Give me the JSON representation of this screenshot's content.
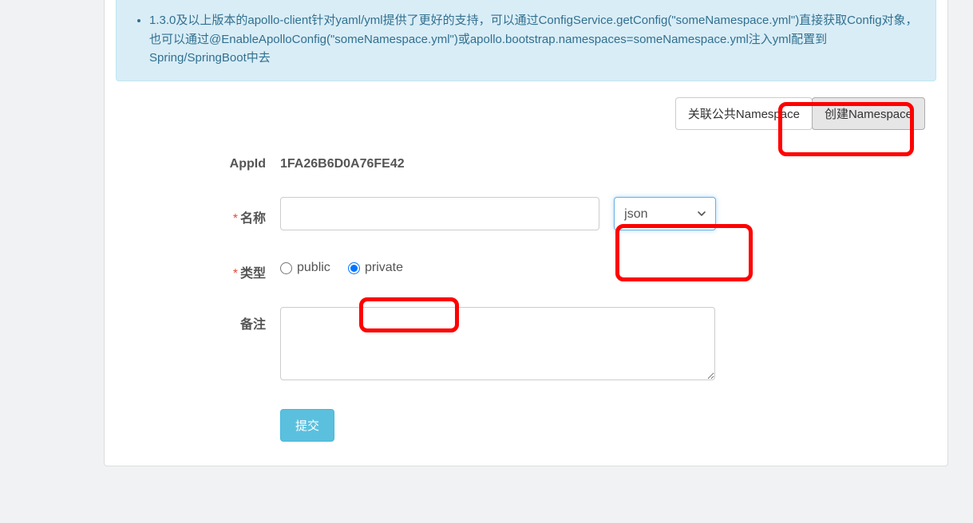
{
  "info": {
    "bullets": [
      "1.3.0及以上版本的apollo-client针对yaml/yml提供了更好的支持，可以通过ConfigService.getConfig(\"someNamespace.yml\")直接获取Config对象，也可以通过@EnableApolloConfig(\"someNamespace.yml\")或apollo.bootstrap.namespaces=someNamespace.yml注入yml配置到Spring/SpringBoot中去"
    ]
  },
  "buttons": {
    "link_public": "关联公共Namespace",
    "create_ns": "创建Namespace"
  },
  "form": {
    "appid_label": "AppId",
    "appid_value": "1FA26B6D0A76FE42",
    "name_label": "名称",
    "name_value": "",
    "type_select_value": "json",
    "type_label": "类型",
    "radio_public": "public",
    "radio_private": "private",
    "radio_selected": "private",
    "remark_label": "备注",
    "remark_value": "",
    "submit": "提交"
  }
}
